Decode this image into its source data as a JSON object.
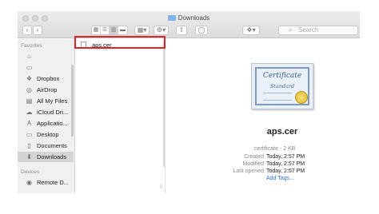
{
  "window": {
    "title": "Downloads"
  },
  "toolbar": {
    "back": "‹",
    "forward": "›",
    "search_placeholder": "Search"
  },
  "sidebar": {
    "favorites_heading": "Favorites",
    "favorites": [
      {
        "label": "",
        "icon": "home-icon"
      },
      {
        "label": "",
        "icon": "folder-icon"
      },
      {
        "label": "Dropbox",
        "icon": "dropbox-icon"
      },
      {
        "label": "AirDrop",
        "icon": "airdrop-icon"
      },
      {
        "label": "All My Files",
        "icon": "all-files-icon"
      },
      {
        "label": "iCloud Dri...",
        "icon": "cloud-icon"
      },
      {
        "label": "Applicatio...",
        "icon": "applications-icon"
      },
      {
        "label": "Desktop",
        "icon": "desktop-icon"
      },
      {
        "label": "Documents",
        "icon": "documents-icon"
      },
      {
        "label": "Downloads",
        "icon": "downloads-icon",
        "selected": true
      }
    ],
    "devices_heading": "Devices",
    "devices": [
      {
        "label": "Remote D...",
        "icon": "remote-disc-icon"
      }
    ]
  },
  "file_list": {
    "items": [
      {
        "name": "aps.cer",
        "selected": true
      }
    ]
  },
  "preview": {
    "cert_title": "Certificate",
    "cert_subtitle": "Standard",
    "name": "aps.cer",
    "kind": "certificate - 2 KB",
    "created_label": "Created",
    "created_value": "Today, 2:57 PM",
    "modified_label": "Modified",
    "modified_value": "Today, 2:57 PM",
    "last_opened_label": "Last opened",
    "last_opened_value": "Today, 2:57 PM",
    "add_tags": "Add Tags..."
  },
  "colors": {
    "highlight": "#d9262c",
    "link": "#2a6fd6",
    "selection": "#d4d4d4"
  }
}
